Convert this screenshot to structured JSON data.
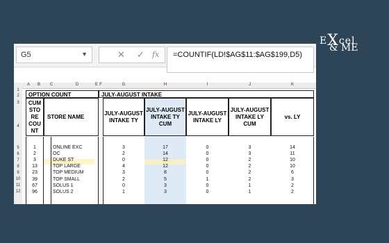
{
  "logo": {
    "line1": "cel",
    "x": "X",
    "line1_prefix": "E",
    "line2": "& ME"
  },
  "formula_bar": {
    "name_box": "G5",
    "cancel_icon": "✕",
    "enter_icon": "✓",
    "fx_label": "fx",
    "formula": "=COUNTIF(LD!$AG$11:$AG$199,D5)"
  },
  "columns": [
    "A",
    "B",
    "C",
    "D",
    "E",
    "F",
    "G",
    "H",
    "I",
    "J",
    "K"
  ],
  "rows": [
    "1",
    "2",
    "3",
    "4",
    "5",
    "6",
    "7",
    "8",
    "9",
    "10",
    "11",
    "12"
  ],
  "header": {
    "option_count": "OPTION COUNT",
    "intake": "JULY-AUGUST INTAKE",
    "cum_store_count": "CUM STO RE COU NT",
    "store_name": "STORE NAME",
    "col_g": "JULY-AUGUST INTAKE TY",
    "col_h": "JULY-AUGUST INTAKE TY CUM",
    "col_i": "JULY-AUGUST INTAKE LY",
    "col_j": "JULY-AUGUST INTAKE LY CUM",
    "col_k": "vs. LY"
  },
  "table_rows": [
    {
      "c": "1",
      "d": "ONLINE EXC",
      "g": "3",
      "h": "17",
      "i": "0",
      "j": "3",
      "k": "14"
    },
    {
      "c": "2",
      "d": "OC",
      "g": "2",
      "h": "14",
      "i": "0",
      "j": "3",
      "k": "11"
    },
    {
      "c": "3",
      "d": "DUKE ST",
      "g": "0",
      "h": "12",
      "i": "0",
      "j": "2",
      "k": "10"
    },
    {
      "c": "13",
      "d": "TOP LARGE",
      "g": "4",
      "h": "12",
      "i": "0",
      "j": "2",
      "k": "10"
    },
    {
      "c": "23",
      "d": "TOP MEDIUM",
      "g": "3",
      "h": "8",
      "i": "0",
      "j": "2",
      "k": "6"
    },
    {
      "c": "39",
      "d": "TOP SMALL",
      "g": "2",
      "h": "5",
      "i": "1",
      "j": "2",
      "k": "3"
    },
    {
      "c": "67",
      "d": "SOLUS 1",
      "g": "0",
      "h": "3",
      "i": "0",
      "j": "1",
      "k": "2"
    },
    {
      "c": "96",
      "d": "SOLUS 2",
      "g": "1",
      "h": "3",
      "i": "0",
      "j": "1",
      "k": "2"
    }
  ]
}
